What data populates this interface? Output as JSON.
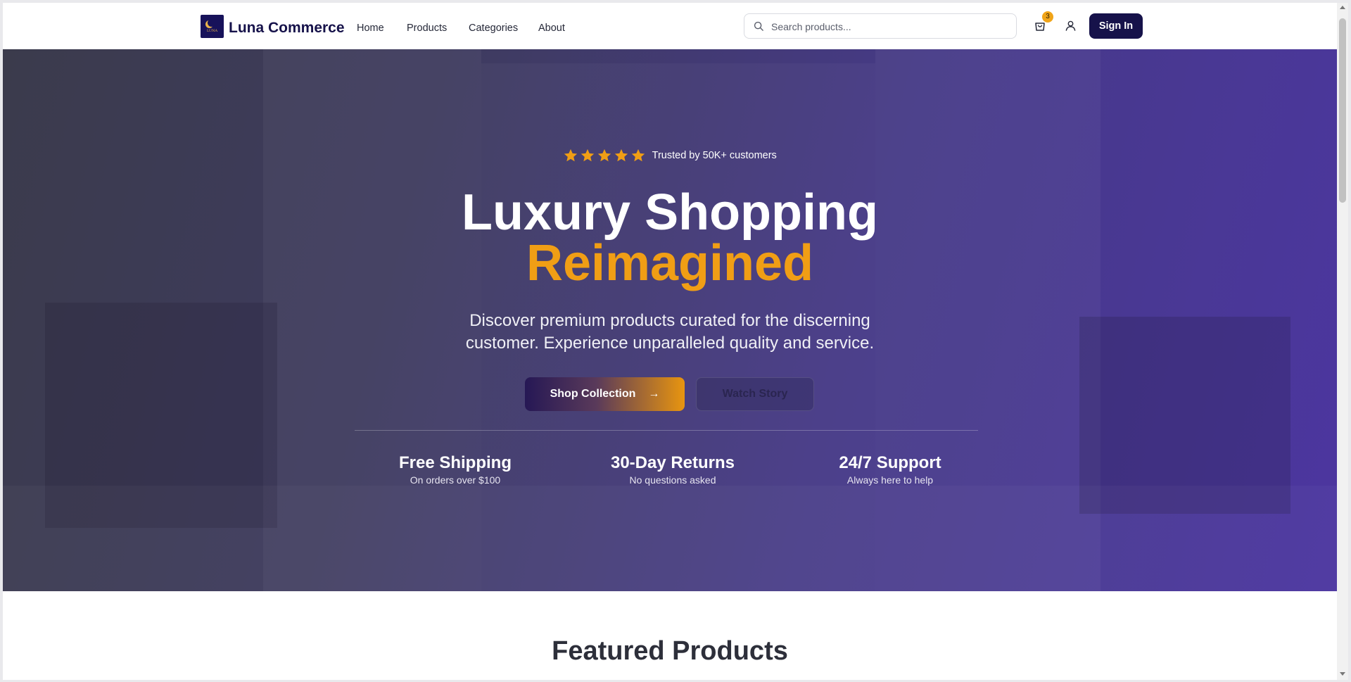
{
  "header": {
    "brand": "Luna Commerce",
    "logo_text": "LUNA",
    "nav": [
      "Home",
      "Products",
      "Categories",
      "About"
    ],
    "search_placeholder": "Search products...",
    "cart_count": "3",
    "sign_in": "Sign In"
  },
  "hero": {
    "rating_stars": 5,
    "trust_text": "Trusted by 50K+ customers",
    "title_line1": "Luxury Shopping",
    "title_line2": "Reimagined",
    "subtitle": "Discover premium products curated for the discerning customer. Experience unparalleled quality and service.",
    "primary_cta": "Shop Collection",
    "secondary_cta": "Watch Story",
    "features": [
      {
        "title": "Free Shipping",
        "desc": "On orders over $100"
      },
      {
        "title": "30-Day Returns",
        "desc": "No questions asked"
      },
      {
        "title": "24/7 Support",
        "desc": "Always here to help"
      }
    ]
  },
  "featured": {
    "title": "Featured Products"
  },
  "colors": {
    "brand_navy": "#16124a",
    "accent_orange": "#f09e15",
    "hero_purple": "#4c36a0"
  }
}
